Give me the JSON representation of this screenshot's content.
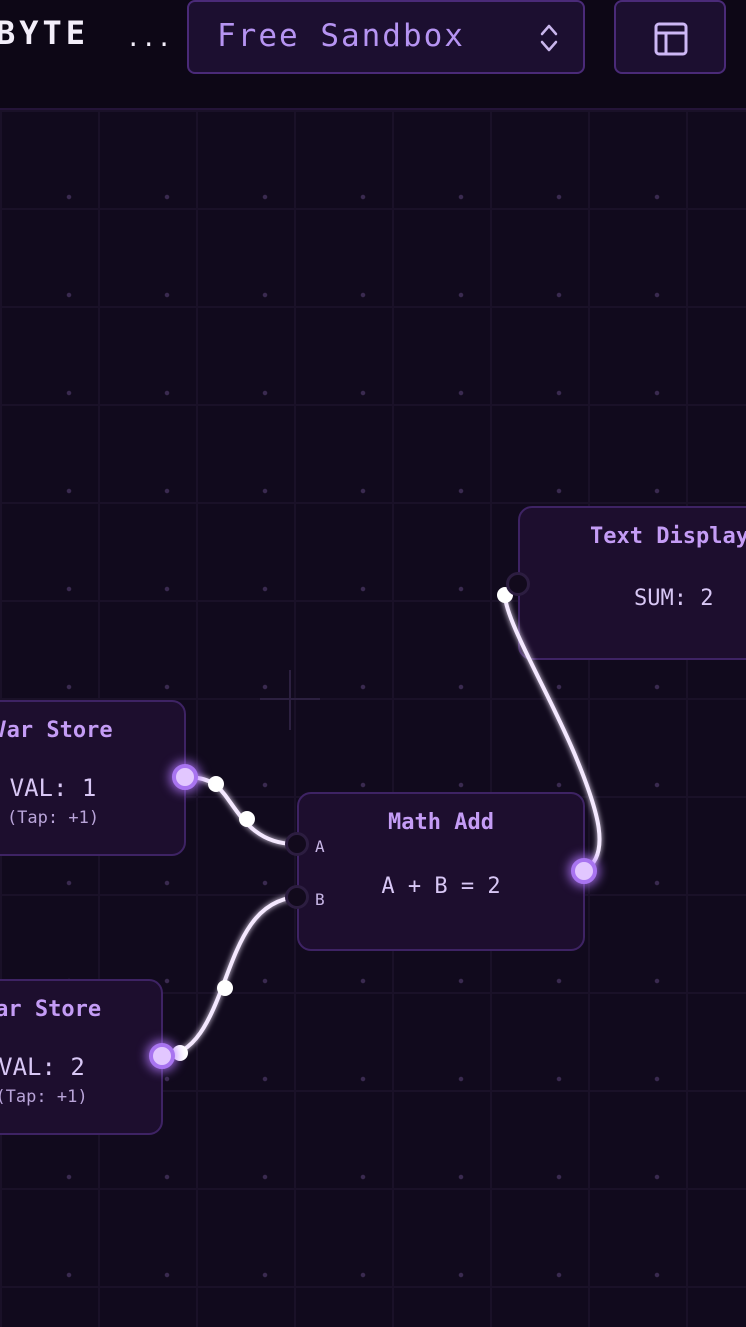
{
  "header": {
    "brand": "BYTE",
    "brand_ellipsis": "...",
    "mode_selector": {
      "selected": "Free Sandbox"
    }
  },
  "icons": {
    "mode_caret": "chevron-up-down-icon",
    "view_toggle": "layout-icon"
  },
  "colors": {
    "accent": "#a874f0",
    "wire": "#f3e6ff",
    "node_title": "#c49cf5"
  },
  "nodes": {
    "text_display": {
      "title": "Text Display",
      "value": "SUM: 2"
    },
    "var_store_1": {
      "title": "Var Store",
      "value": "VAL: 1",
      "hint": "(Tap: +1)"
    },
    "var_store_2": {
      "title": "Var Store",
      "value": "VAL: 2",
      "hint": "(Tap: +1)"
    },
    "math_add": {
      "title": "Math Add",
      "value": "A + B = 2",
      "port_a": "A",
      "port_b": "B"
    }
  }
}
